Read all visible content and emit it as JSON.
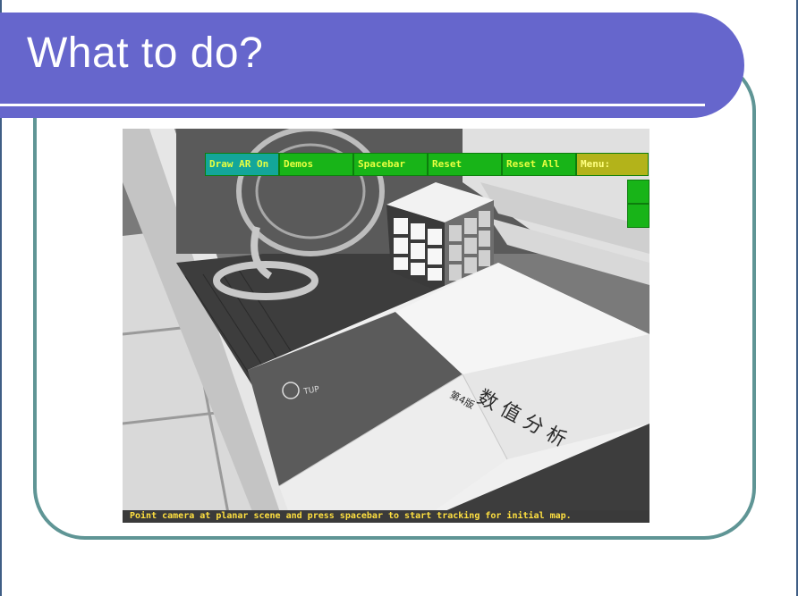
{
  "slide": {
    "title": "What to do?"
  },
  "ar_app": {
    "menu_buttons": [
      "Draw AR On",
      "Demos",
      "Spacebar",
      "Reset",
      "Reset All"
    ],
    "menu_label": "Menu:",
    "status_message": "Point camera at planar scene and press spacebar to start tracking for initial map.",
    "book_cover": {
      "title_cn": "数 值 分 析",
      "edition": "第4版",
      "publisher": "TUP"
    }
  },
  "colors": {
    "banner": "#6666cc",
    "frame_border": "#5f9595",
    "menu_button": "#18b418",
    "menu_label": "#b3b31a",
    "status_text": "#ffe040"
  }
}
